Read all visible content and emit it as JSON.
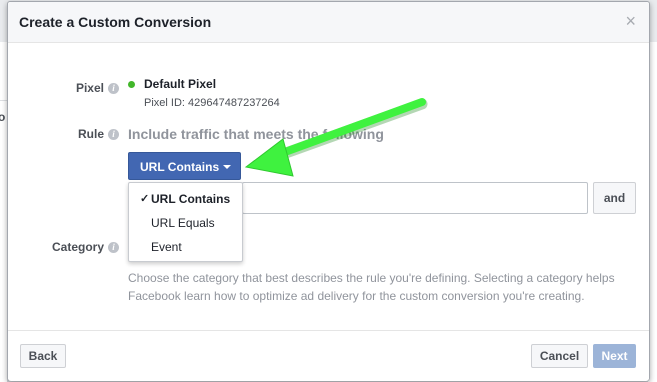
{
  "dialog": {
    "title": "Create a Custom Conversion",
    "close_glyph": "×"
  },
  "background": {
    "partial_text": "o"
  },
  "pixel": {
    "label": "Pixel",
    "status_color": "#42b72a",
    "name": "Default Pixel",
    "id_text": "Pixel ID: 429647487237264"
  },
  "rule": {
    "label": "Rule",
    "description": "Include traffic that meets the following",
    "dropdown": {
      "selected": "URL Contains",
      "options": [
        {
          "label": "URL Contains",
          "selected": true
        },
        {
          "label": "URL Equals",
          "selected": false
        },
        {
          "label": "Event",
          "selected": false
        }
      ]
    },
    "url_value": "",
    "and_label": "and"
  },
  "category": {
    "label": "Category",
    "help_text": "Choose the category that best describes the rule you're defining. Selecting a category helps Facebook learn how to optimize ad delivery for the custom conversion you're creating."
  },
  "footer": {
    "back_label": "Back",
    "cancel_label": "Cancel",
    "next_label": "Next"
  },
  "icons": {
    "info": "info-icon",
    "check": "checkmark-icon",
    "close": "close-icon",
    "caret": "caret-down-icon"
  },
  "colors": {
    "accent": "#4267b2",
    "disabled_accent": "#9cb4d8",
    "annotation_arrow": "#3ff23f"
  }
}
